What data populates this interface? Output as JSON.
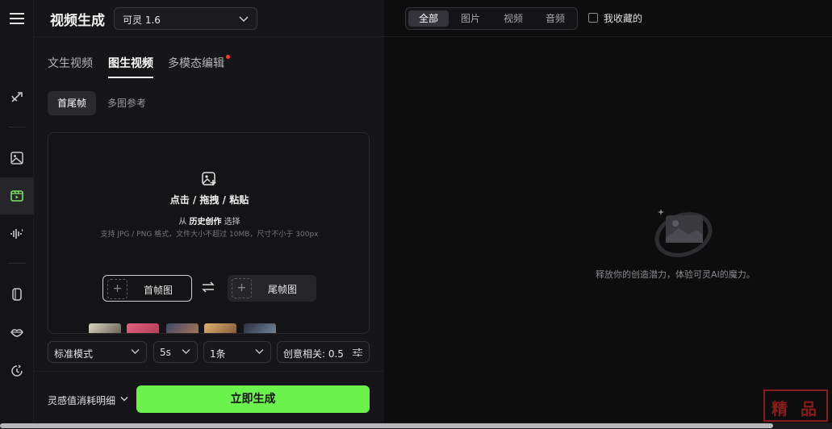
{
  "header": {
    "title": "视频生成",
    "model_value": "可灵 1.6"
  },
  "mode_tabs": [
    {
      "label": "文生视频",
      "active": false
    },
    {
      "label": "图生视频",
      "active": true
    },
    {
      "label": "多模态编辑",
      "active": false,
      "badge_dot": true
    }
  ],
  "sub_tabs": [
    {
      "label": "首尾帧",
      "active": true
    },
    {
      "label": "多图参考",
      "active": false
    }
  ],
  "upload": {
    "main": "点击 / 拖拽 / 粘贴",
    "from_prefix": "从",
    "from_link": "历史创作",
    "from_suffix": "选择",
    "hint": "支持 JPG / PNG 格式，文件大小不超过 10MB，尺寸不小于 300px",
    "first_frame_label": "首帧图",
    "last_frame_label": "尾帧图"
  },
  "options": {
    "mode": "标准模式",
    "duration": "5s",
    "count": "1条",
    "creativity": "创意相关: 0.5"
  },
  "footer": {
    "cost_label": "灵感值消耗明细",
    "generate_label": "立即生成"
  },
  "filters": [
    {
      "label": "全部",
      "active": true
    },
    {
      "label": "图片",
      "active": false
    },
    {
      "label": "视频",
      "active": false
    },
    {
      "label": "音频",
      "active": false
    }
  ],
  "favorites_label": "我收藏的",
  "empty_text": "释放你的创造潜力，体验可灵AI的魔力。",
  "watermark": {
    "c1": "精",
    "c2": "品"
  },
  "colors": {
    "accent": "#6cf24d",
    "badge": "#ff3b30",
    "active_rail": "#7ee25f"
  }
}
